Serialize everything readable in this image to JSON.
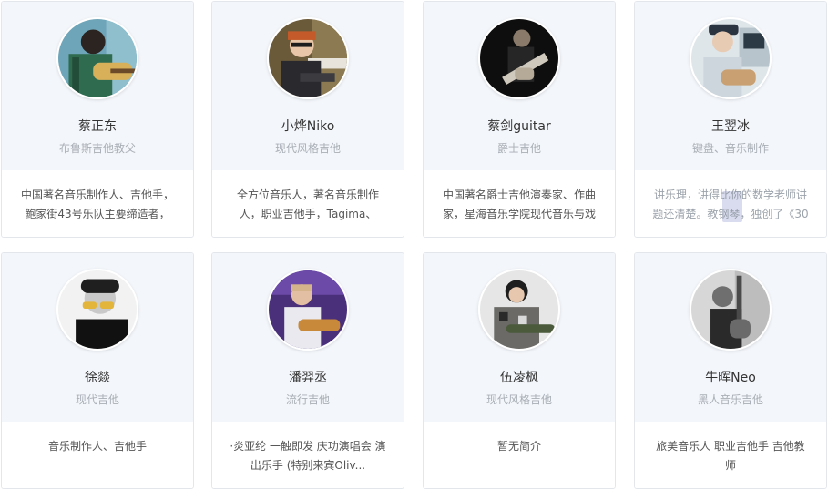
{
  "cards": [
    {
      "name": "蔡正东",
      "genre": "布鲁斯吉他教父",
      "bio": "中国著名音乐制作人、吉他手，鲍家街43号乐队主要缔造者，"
    },
    {
      "name": "小烨Niko",
      "genre": "现代风格吉他",
      "bio": "全方位音乐人，著名音乐制作人，职业吉他手，Tagima、La..."
    },
    {
      "name": "蔡剑guitar",
      "genre": "爵士吉他",
      "bio": "中国著名爵士吉他演奏家、作曲家，星海音乐学院现代音乐与戏"
    },
    {
      "name": "王翌冰",
      "genre": "键盘、音乐制作",
      "bio": "讲乐理，讲得比你的数学老师讲题还清楚。教钢琴，独创了《30"
    },
    {
      "name": "徐燚",
      "genre": "现代吉他",
      "bio": "音乐制作人、吉他手"
    },
    {
      "name": "潘羿丞",
      "genre": "流行吉他",
      "bio": "·炎亚纶 一触即发 庆功演唱会 演出乐手 (特别来宾Oliv..."
    },
    {
      "name": "伍凌枫",
      "genre": "现代风格吉他",
      "bio": "暂无简介"
    },
    {
      "name": "牛晖Neo",
      "genre": "黑人音乐吉他",
      "bio": "旅美音乐人 职业吉他手 吉他教师"
    }
  ]
}
